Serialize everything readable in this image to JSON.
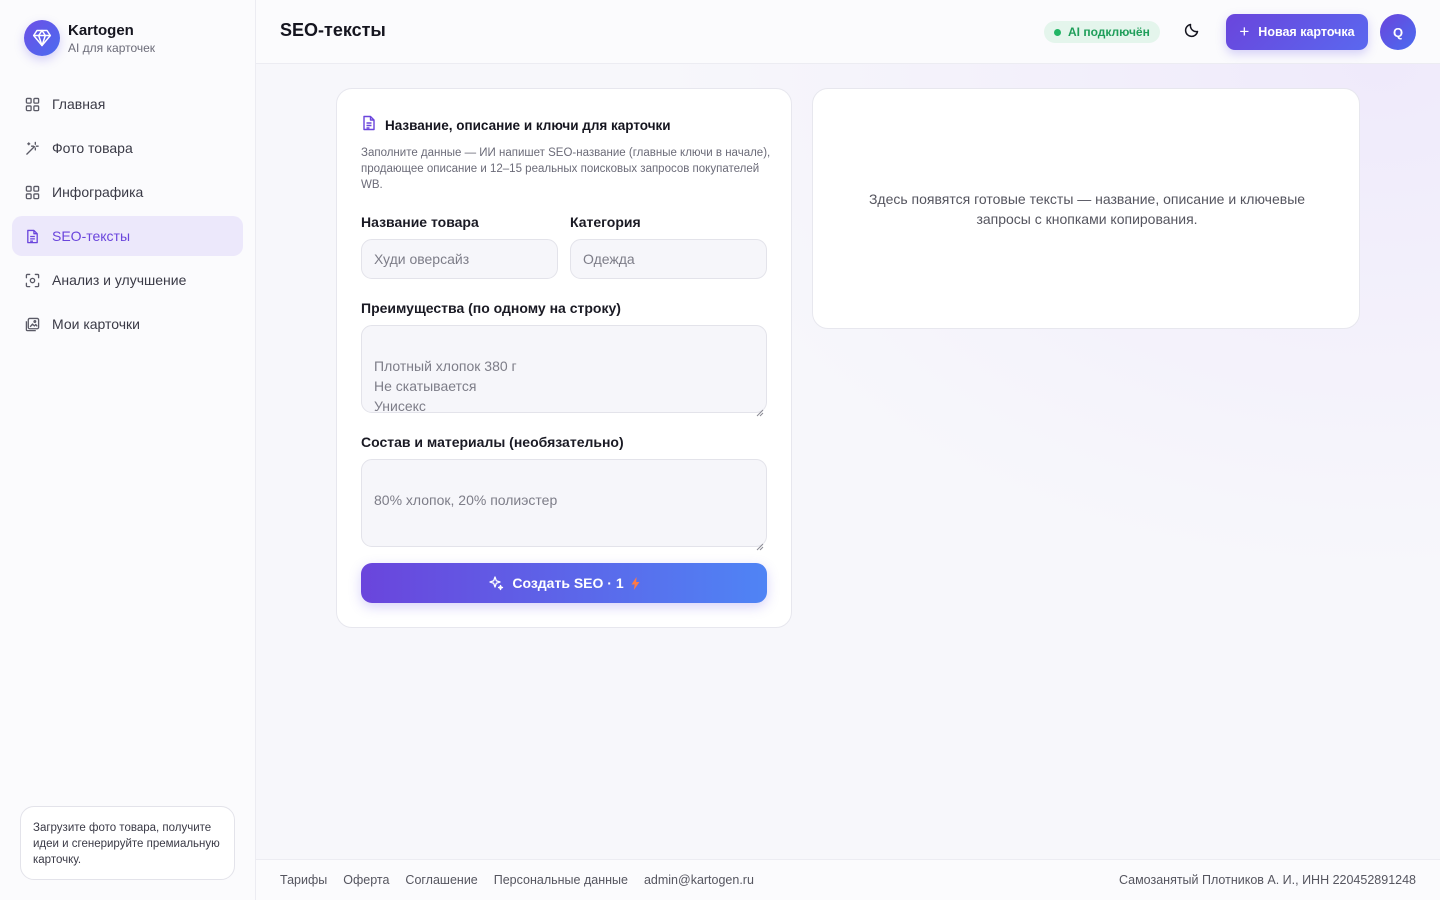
{
  "brand": {
    "name": "Kartogen",
    "subtitle": "AI для карточек",
    "logo_icon": "diamond-icon"
  },
  "sidebar": {
    "items": [
      {
        "label": "Главная",
        "icon": "grid-icon",
        "active": false
      },
      {
        "label": "Фото товара",
        "icon": "magic-wand-icon",
        "active": false
      },
      {
        "label": "Инфографика",
        "icon": "grid-icon",
        "active": false
      },
      {
        "label": "SEO-тексты",
        "icon": "document-icon",
        "active": true
      },
      {
        "label": "Анализ и улучшение",
        "icon": "scan-icon",
        "active": false
      },
      {
        "label": "Мои карточки",
        "icon": "images-icon",
        "active": false
      }
    ],
    "tip": "Загрузите фото товара, получите идеи и сгенерируйте премиальную карточку."
  },
  "header": {
    "title": "SEO-тексты",
    "ai_status": "AI подключён",
    "new_card_label": "Новая карточка",
    "avatar_initial": "Q"
  },
  "form": {
    "title": "Название, описание и ключи для карточки",
    "description": "Заполните данные — ИИ напишет SEO-название (главные ключи в начале), продающее описание и 12–15 реальных поисковых запросов покупателей WB.",
    "product_name_label": "Название товара",
    "product_name_placeholder": "Худи оверсайз",
    "category_label": "Категория",
    "category_placeholder": "Одежда",
    "benefits_label": "Преимущества (по одному на строку)",
    "benefits_placeholder": "Плотный хлопок 380 г\nНе скатывается\nУнисекс",
    "composition_label": "Состав и материалы (необязательно)",
    "composition_placeholder": "80% хлопок, 20% полиэстер",
    "submit_label": "Создать SEO · 1"
  },
  "result": {
    "placeholder": "Здесь появятся готовые тексты — название, описание и ключевые запросы с кнопками копирования."
  },
  "footer": {
    "links": [
      "Тарифы",
      "Оферта",
      "Соглашение",
      "Персональные данные",
      "admin@kartogen.ru"
    ],
    "legal": "Самозанятый Плотников А. И., ИНН 220452891248"
  },
  "colors": {
    "accent": "#6a45dc",
    "accent_blue": "#4f84f5",
    "success": "#22b565",
    "active_bg": "#ece8fb"
  }
}
